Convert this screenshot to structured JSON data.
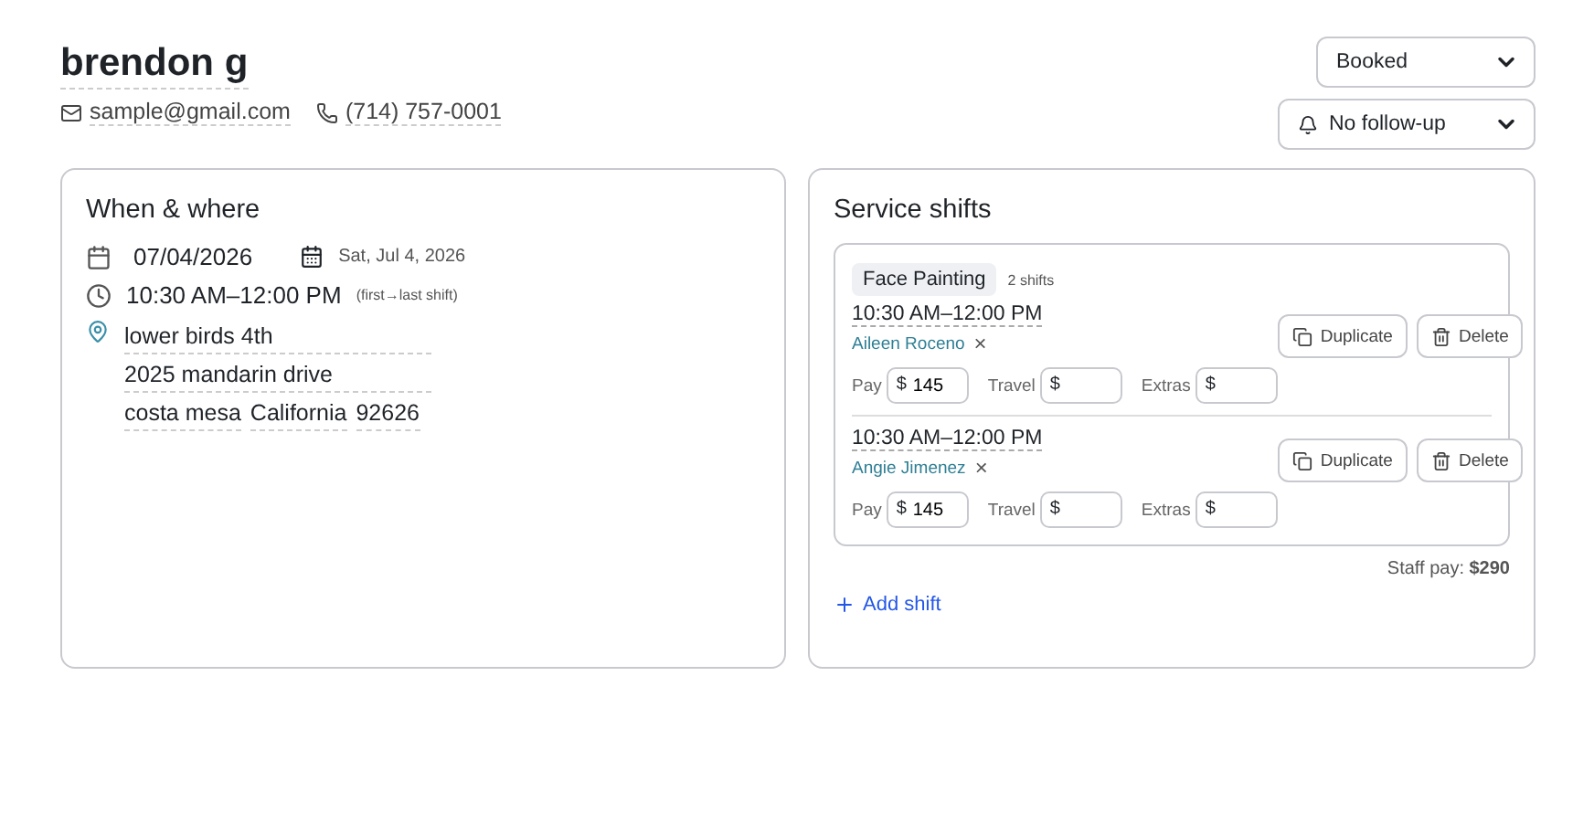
{
  "client": {
    "name": "brendon g",
    "email": "sample@gmail.com",
    "phone": "(714) 757-0001"
  },
  "status_select": {
    "value": "Booked"
  },
  "followup_select": {
    "value": "No follow-up"
  },
  "when_where": {
    "title": "When & where",
    "date": "07/04/2026",
    "date_label": "Sat, Jul 4, 2026",
    "time": "10:30 AM–12:00 PM",
    "time_note": "(first→last shift)",
    "address": {
      "line1": "lower birds 4th",
      "line2": "2025 mandarin drive",
      "city": "costa mesa",
      "state": "California",
      "zip": "92626"
    }
  },
  "service_shifts": {
    "title": "Service shifts",
    "groups": [
      {
        "service": "Face Painting",
        "count": "2 shifts",
        "shifts": [
          {
            "time": "10:30 AM–12:00 PM",
            "staff": "Aileen Roceno",
            "remove": "×",
            "duplicate": "Duplicate",
            "delete": "Delete",
            "fields": [
              {
                "label": "Pay",
                "prefix": "$",
                "value": "145"
              },
              {
                "label": "Travel",
                "prefix": "$"
              },
              {
                "label": "Extras",
                "prefix": "$"
              }
            ]
          },
          {
            "time": "10:30 AM–12:00 PM",
            "staff": "Angie Jimenez",
            "remove": "×",
            "duplicate": "Duplicate",
            "delete": "Delete",
            "fields": [
              {
                "label": "Pay",
                "prefix": "$",
                "value": "145"
              },
              {
                "label": "Travel",
                "prefix": "$"
              },
              {
                "label": "Extras",
                "prefix": "$"
              }
            ]
          }
        ]
      }
    ],
    "staff_pay": "Staff pay: **$290**",
    "add_shift": "Add shift"
  }
}
